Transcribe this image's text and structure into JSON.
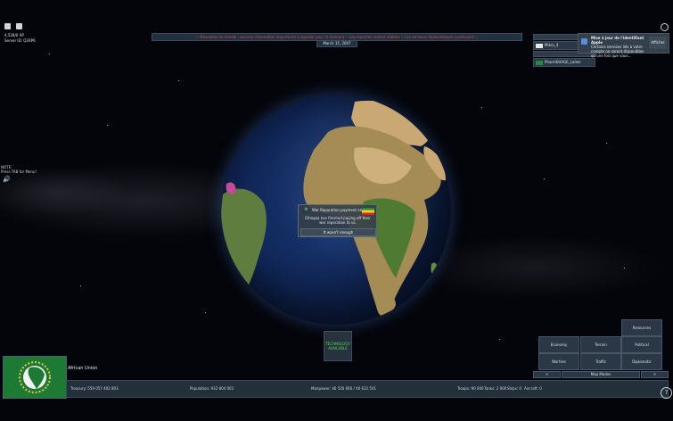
{
  "top_left": {
    "line1": "4,528/0 XP",
    "line2": "Server ID: Q3XP6"
  },
  "banner": {
    "text": "~ Nouvelles du monde : aucune information importante a signaler pour le moment ~ Les marches restent stables ~ Les tensions diplomatiques continuent ~"
  },
  "date": "March 15, 2047",
  "side_note": {
    "line1": "NOTE:",
    "line2": "Press TAB for Menu!"
  },
  "players": [
    {
      "name": "Mikro_4",
      "flag": "white"
    },
    {
      "name": "PharmEHAGE_Lallen",
      "flag": "green"
    }
  ],
  "notification": {
    "title": "Mise à jour de l'identifiant Apple",
    "body": "Certains services liés à votre compte ne seront disponibles qu'une fois que vous...",
    "button": "Afficher"
  },
  "event_popup": {
    "title": "War Reparation payment ended",
    "body": "Ethiopia has finished paying off their war reparation to us.",
    "button": "It wasn't enough"
  },
  "technology": {
    "line1": "TECHNOLOGY",
    "line2": "AVAILABLE"
  },
  "right_menu": {
    "resources": "Resources",
    "economy": "Economy",
    "terrain": "Terrain",
    "political": "Political",
    "warfare": "Warfare",
    "traffic": "Traffic",
    "diplomatic": "Diplomatic",
    "prev": "<",
    "mode": "Map Modes",
    "next": ">"
  },
  "country": {
    "name": "African Union"
  },
  "status_bar": {
    "treasury": "Treasury:  559 057 402 803",
    "population": "Population: 932 804 003",
    "manpower": "Manpower:  46 526 066  /  46 632 501",
    "troops": "Troops: 90 000",
    "tanks": "Tanks: 2 000",
    "ships": "Ships: 0",
    "aircraft": "Aircraft: 0"
  },
  "colors": {
    "accent_green": "#58d35a",
    "panel": "#2b3744",
    "alert_red": "#d24b4b"
  }
}
